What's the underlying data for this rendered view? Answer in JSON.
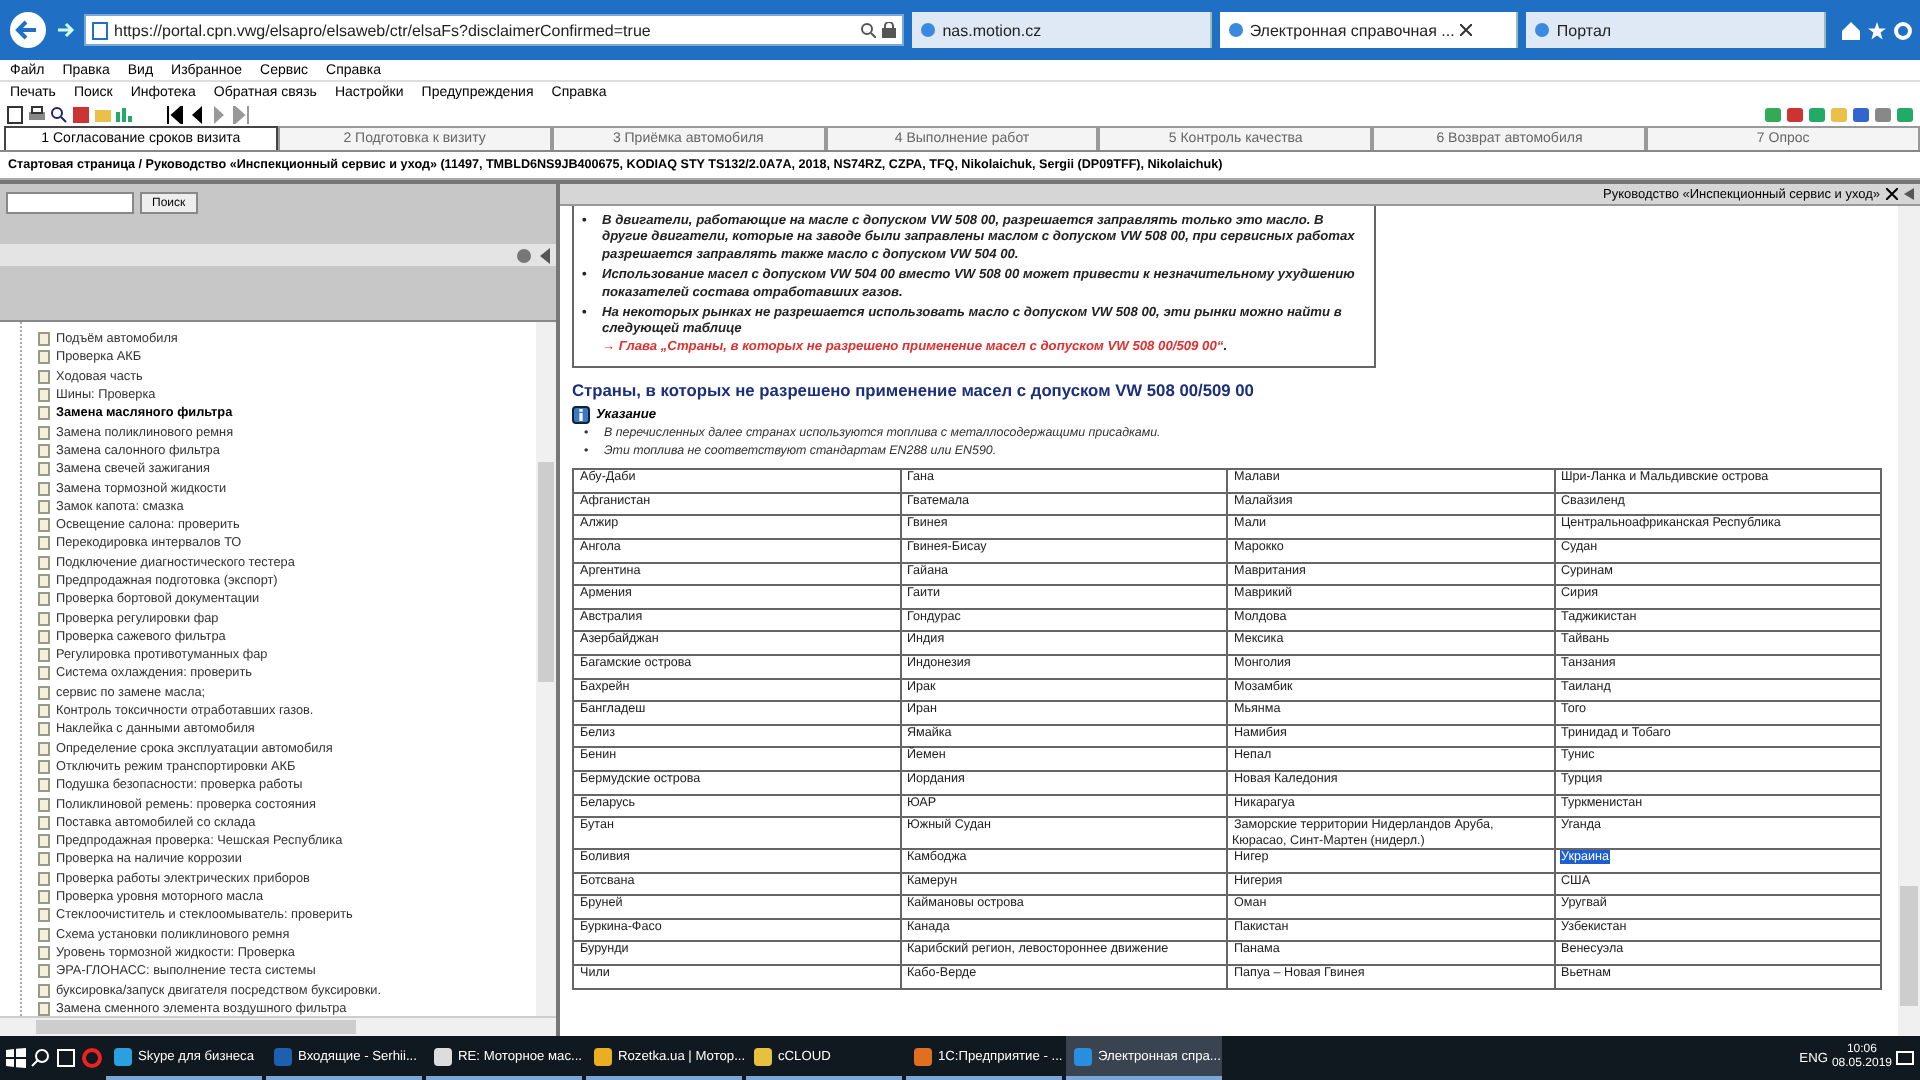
{
  "browser": {
    "address": "https://portal.cpn.vwg/elsapro/elsaweb/ctr/elsaFs?disclaimerConfirmed=true",
    "tabs": [
      {
        "label": "nas.motion.cz",
        "selected": false
      },
      {
        "label": "Электронная справочная ...",
        "selected": true
      },
      {
        "label": "Портал",
        "selected": false
      }
    ],
    "menu": [
      "Файл",
      "Правка",
      "Вид",
      "Избранное",
      "Сервис",
      "Справка"
    ]
  },
  "app": {
    "menu": [
      "Печать",
      "Поиск",
      "Инфотека",
      "Обратная связь",
      "Настройки",
      "Предупреждения",
      "Справка"
    ],
    "steps": [
      {
        "label": "1 Согласование сроков визита",
        "selected": true
      },
      {
        "label": "2 Подготовка к визиту",
        "selected": false
      },
      {
        "label": "3 Приёмка автомобиля",
        "selected": false
      },
      {
        "label": "4 Выполнение работ",
        "selected": false
      },
      {
        "label": "5 Контроль качества",
        "selected": false
      },
      {
        "label": "6 Возврат автомобиля",
        "selected": false
      },
      {
        "label": "7 Опрос",
        "selected": false
      }
    ],
    "breadcrumb": "Стартовая страница / Руководство «Инспекционный сервис и уход» (11497, TMBLD6NS9JB400675, KODIAQ STY TS132/2.0A7A, 2018, NS74RZ, CZPA, TFQ, Nikolaichuk, Sergii (DP09TFF), Nikolaichuk)"
  },
  "sidebar": {
    "search_button": "Поиск",
    "items": [
      {
        "label": "Подъём автомобиля",
        "selected": false
      },
      {
        "label": "Проверка АКБ",
        "selected": false
      },
      {
        "label": "Ходовая часть",
        "selected": false
      },
      {
        "label": "Шины: Проверка",
        "selected": false
      },
      {
        "label": "Замена масляного фильтра",
        "selected": true
      },
      {
        "label": "Замена поликлинового ремня",
        "selected": false
      },
      {
        "label": "Замена салонного фильтра",
        "selected": false
      },
      {
        "label": "Замена свечей зажигания",
        "selected": false
      },
      {
        "label": "Замена тормозной жидкости",
        "selected": false
      },
      {
        "label": "Замок капота: смазка",
        "selected": false
      },
      {
        "label": "Освещение салона: проверить",
        "selected": false
      },
      {
        "label": "Перекодировка интервалов ТО",
        "selected": false
      },
      {
        "label": "Подключение диагностического тестера",
        "selected": false
      },
      {
        "label": "Предпродажная подготовка (экспорт)",
        "selected": false
      },
      {
        "label": "Проверка бортовой документации",
        "selected": false
      },
      {
        "label": "Проверка регулировки фар",
        "selected": false
      },
      {
        "label": "Проверка сажевого фильтра",
        "selected": false
      },
      {
        "label": "Регулировка противотуманных фар",
        "selected": false
      },
      {
        "label": "Система охлаждения: проверить",
        "selected": false
      },
      {
        "label": "сервис по замене масла;",
        "selected": false
      },
      {
        "label": "Контроль токсичности отработавших газов.",
        "selected": false
      },
      {
        "label": "Наклейка с данными автомобиля",
        "selected": false
      },
      {
        "label": "Определение срока эксплуатации автомобиля",
        "selected": false
      },
      {
        "label": "Отключить режим транспортировки АКБ",
        "selected": false
      },
      {
        "label": "Подушка безопасности: проверка работы",
        "selected": false
      },
      {
        "label": "Поликлиновой ремень: проверка состояния",
        "selected": false
      },
      {
        "label": "Поставка автомобилей со склада",
        "selected": false
      },
      {
        "label": "Предпродажная проверка: Чешская Республика",
        "selected": false
      },
      {
        "label": "Проверка на наличие коррозии",
        "selected": false
      },
      {
        "label": "Проверка работы электрических приборов",
        "selected": false
      },
      {
        "label": "Проверка уровня моторного масла",
        "selected": false
      },
      {
        "label": "Стеклоочиститель и стеклоомыватель: проверить",
        "selected": false
      },
      {
        "label": "Схема установки поликлинового ремня",
        "selected": false
      },
      {
        "label": "Уровень тормозной жидкости: Проверка",
        "selected": false
      },
      {
        "label": "ЭРА-ГЛОНАСС: выполнение теста системы",
        "selected": false
      },
      {
        "label": "буксировка/запуск двигателя посредством буксировки.",
        "selected": false
      },
      {
        "label": "Замена сменного элемента воздушного фильтра",
        "selected": false
      }
    ]
  },
  "document": {
    "title": "Руководство «Инспекционный сервис и уход»",
    "notes": [
      {
        "marker": "•",
        "text": "В двигатели, работающие на масле с допуском VW 508 00, разрешается заправлять только это масло. В другие двигатели, которые на заводе были заправлены маслом с допуском VW 508 00, при сервисных работах разрешается заправлять также масло с допуском VW 504 00."
      },
      {
        "marker": "•",
        "text": "Использование масел с допуском VW 504 00 вместо VW 508 00 может привести к незначительному ухудшению показателей состава отработавших газов."
      },
      {
        "marker": "•",
        "text": "На некоторых рынках не разрешается использовать масло с допуском VW 508 00, эти рынки можно найти в следующей таблице",
        "link": "→ Глава „Страны, в которых не разрешено применение масел с допуском VW 508 00/509 00“",
        "tail": "."
      }
    ],
    "heading": "Страны, в которых не разрешено применение масел с допуском VW 508 00/509 00",
    "hint": {
      "title": "Указание",
      "items": [
        {
          "marker": "•",
          "text": "В перечисленных далее странах используются топлива с металлосодержащими присадками."
        },
        {
          "marker": "•",
          "text": "Эти топлива не соответствуют стандартам EN288 или EN590."
        }
      ]
    },
    "table": {
      "rows": [
        [
          {
            "text": "Абу-Даби",
            "selected": false
          },
          {
            "text": "Гана",
            "selected": false
          },
          {
            "text": "Малави",
            "selected": false
          },
          {
            "text": "Шри-Ланка и Мальдивские острова",
            "selected": false
          }
        ],
        [
          {
            "text": "Афганистан",
            "selected": false
          },
          {
            "text": "Гватемала",
            "selected": false
          },
          {
            "text": "Малайзия",
            "selected": false
          },
          {
            "text": "Свазиленд",
            "selected": false
          }
        ],
        [
          {
            "text": "Алжир",
            "selected": false
          },
          {
            "text": "Гвинея",
            "selected": false
          },
          {
            "text": "Мали",
            "selected": false
          },
          {
            "text": "Центральноафриканская Республика",
            "selected": false
          }
        ],
        [
          {
            "text": "Ангола",
            "selected": false
          },
          {
            "text": "Гвинея-Бисау",
            "selected": false
          },
          {
            "text": "Марокко",
            "selected": false
          },
          {
            "text": "Судан",
            "selected": false
          }
        ],
        [
          {
            "text": "Аргентина",
            "selected": false
          },
          {
            "text": "Гайана",
            "selected": false
          },
          {
            "text": "Мавритания",
            "selected": false
          },
          {
            "text": "Суринам",
            "selected": false
          }
        ],
        [
          {
            "text": "Армения",
            "selected": false
          },
          {
            "text": "Гаити",
            "selected": false
          },
          {
            "text": "Маврикий",
            "selected": false
          },
          {
            "text": "Сирия",
            "selected": false
          }
        ],
        [
          {
            "text": "Австралия",
            "selected": false
          },
          {
            "text": "Гондурас",
            "selected": false
          },
          {
            "text": "Молдова",
            "selected": false
          },
          {
            "text": "Таджикистан",
            "selected": false
          }
        ],
        [
          {
            "text": "Азербайджан",
            "selected": false
          },
          {
            "text": "Индия",
            "selected": false
          },
          {
            "text": "Мексика",
            "selected": false
          },
          {
            "text": "Тайвань",
            "selected": false
          }
        ],
        [
          {
            "text": "Багамские острова",
            "selected": false
          },
          {
            "text": "Индонезия",
            "selected": false
          },
          {
            "text": "Монголия",
            "selected": false
          },
          {
            "text": "Танзания",
            "selected": false
          }
        ],
        [
          {
            "text": "Бахрейн",
            "selected": false
          },
          {
            "text": "Ирак",
            "selected": false
          },
          {
            "text": "Мозамбик",
            "selected": false
          },
          {
            "text": "Таиланд",
            "selected": false
          }
        ],
        [
          {
            "text": "Бангладеш",
            "selected": false
          },
          {
            "text": "Иран",
            "selected": false
          },
          {
            "text": "Мьянма",
            "selected": false
          },
          {
            "text": "Того",
            "selected": false
          }
        ],
        [
          {
            "text": "Белиз",
            "selected": false
          },
          {
            "text": "Ямайка",
            "selected": false
          },
          {
            "text": "Намибия",
            "selected": false
          },
          {
            "text": "Тринидад и Тобаго",
            "selected": false
          }
        ],
        [
          {
            "text": "Бенин",
            "selected": false
          },
          {
            "text": "Йемен",
            "selected": false
          },
          {
            "text": "Непал",
            "selected": false
          },
          {
            "text": "Тунис",
            "selected": false
          }
        ],
        [
          {
            "text": "Бермудские острова",
            "selected": false
          },
          {
            "text": "Иордания",
            "selected": false
          },
          {
            "text": "Новая Каледония",
            "selected": false
          },
          {
            "text": "Турция",
            "selected": false
          }
        ],
        [
          {
            "text": "Беларусь",
            "selected": false
          },
          {
            "text": "ЮАР",
            "selected": false
          },
          {
            "text": "Никарагуа",
            "selected": false
          },
          {
            "text": "Туркменистан",
            "selected": false
          }
        ],
        [
          {
            "text": "Бутан",
            "selected": false
          },
          {
            "text": "Южный Судан",
            "selected": false
          },
          {
            "text": "Заморские территории Нидерландов Аруба, Кюрасао, Синт-Мартен (нидерл.)",
            "selected": false
          },
          {
            "text": "Уганда",
            "selected": false
          }
        ],
        [
          {
            "text": "Боливия",
            "selected": false
          },
          {
            "text": "Камбоджа",
            "selected": false
          },
          {
            "text": "Нигер",
            "selected": false
          },
          {
            "text": "Украина",
            "selected": true
          }
        ],
        [
          {
            "text": "Ботсвана",
            "selected": false
          },
          {
            "text": "Камерун",
            "selected": false
          },
          {
            "text": "Нигерия",
            "selected": false
          },
          {
            "text": "США",
            "selected": false
          }
        ],
        [
          {
            "text": "Бруней",
            "selected": false
          },
          {
            "text": "Каймановы острова",
            "selected": false
          },
          {
            "text": "Оман",
            "selected": false
          },
          {
            "text": "Уругвай",
            "selected": false
          }
        ],
        [
          {
            "text": "Буркина-Фасо",
            "selected": false
          },
          {
            "text": "Канада",
            "selected": false
          },
          {
            "text": "Пакистан",
            "selected": false
          },
          {
            "text": "Узбекистан",
            "selected": false
          }
        ],
        [
          {
            "text": "Бурунди",
            "selected": false
          },
          {
            "text": "Карибский регион, левостороннее движение",
            "selected": false
          },
          {
            "text": "Панама",
            "selected": false
          },
          {
            "text": "Венесуэла",
            "selected": false
          }
        ],
        [
          {
            "text": "Чили",
            "selected": false
          },
          {
            "text": "Кабо-Верде",
            "selected": false
          },
          {
            "text": "Папуа – Новая Гвинея",
            "selected": false
          },
          {
            "text": "Вьетнам",
            "selected": false
          }
        ]
      ]
    }
  },
  "taskbar": {
    "items": [
      {
        "label": "Skype для бизнеса",
        "selected": false
      },
      {
        "label": "Входящие - Serhii...",
        "selected": false
      },
      {
        "label": "RE: Моторное мас...",
        "selected": false
      },
      {
        "label": "Rozetka.ua | Мотор...",
        "selected": false
      },
      {
        "label": "cCLOUD",
        "selected": false
      },
      {
        "label": "1С:Предприятие - ...",
        "selected": false
      },
      {
        "label": "Электронная спра...",
        "selected": true
      }
    ],
    "lang": "ENG",
    "time": "10:06",
    "date": "08.05.2019"
  }
}
